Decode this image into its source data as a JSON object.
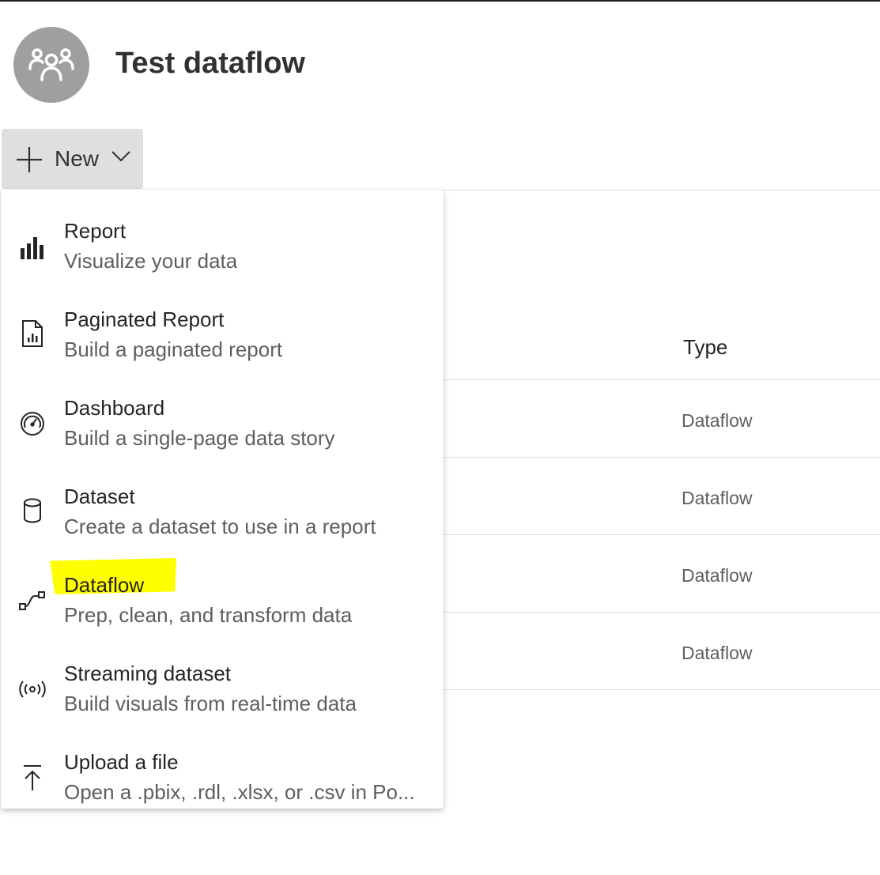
{
  "page": {
    "title": "Test dataflow"
  },
  "toolbar": {
    "new_label": "New"
  },
  "table": {
    "type_header": "Type",
    "rows": [
      {
        "type": "Dataflow"
      },
      {
        "type": "Dataflow"
      },
      {
        "type": "Dataflow"
      },
      {
        "type": "Dataflow"
      }
    ]
  },
  "menu": {
    "items": [
      {
        "title": "Report",
        "description": "Visualize your data",
        "icon": "bar-chart-icon"
      },
      {
        "title": "Paginated Report",
        "description": "Build a paginated report",
        "icon": "paginated-report-icon"
      },
      {
        "title": "Dashboard",
        "description": "Build a single-page data story",
        "icon": "gauge-icon"
      },
      {
        "title": "Dataset",
        "description": "Create a dataset to use in a report",
        "icon": "database-icon"
      },
      {
        "title": "Dataflow",
        "description": "Prep, clean, and transform data",
        "icon": "dataflow-icon",
        "highlighted": true
      },
      {
        "title": "Streaming dataset",
        "description": "Build visuals from real-time data",
        "icon": "broadcast-icon"
      },
      {
        "title": "Upload a file",
        "description": "Open a .pbix, .rdl, .xlsx, or .csv in Po...",
        "icon": "upload-icon"
      }
    ]
  },
  "colors": {
    "highlight": "#ffff00",
    "avatar": "#a19f9d",
    "button_bg": "#e1dfdd"
  }
}
